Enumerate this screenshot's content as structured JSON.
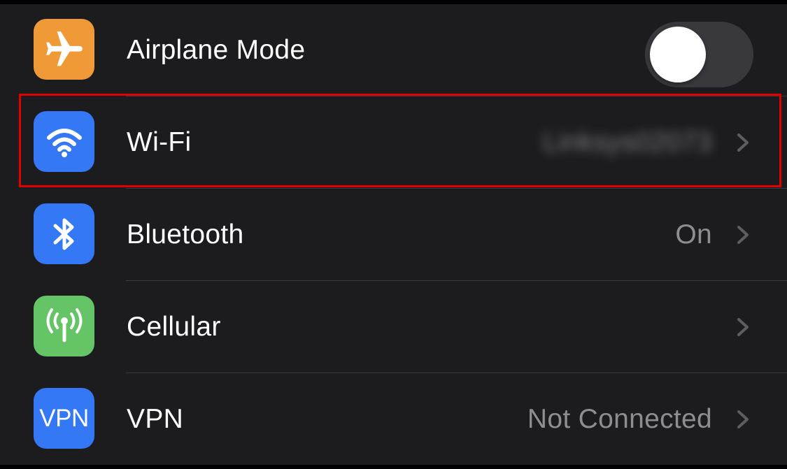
{
  "settings": {
    "rows": [
      {
        "label": "Airplane Mode",
        "icon": "airplane-icon",
        "icon_color": "#f09a37",
        "toggle_on": false
      },
      {
        "label": "Wi-Fi",
        "icon": "wifi-icon",
        "icon_color": "#3478f6",
        "value": "Linksys02073",
        "value_blurred": true
      },
      {
        "label": "Bluetooth",
        "icon": "bluetooth-icon",
        "icon_color": "#3478f6",
        "value": "On"
      },
      {
        "label": "Cellular",
        "icon": "cellular-antenna-icon",
        "icon_color": "#65c466",
        "value": ""
      },
      {
        "label": "VPN",
        "icon": "vpn-icon",
        "icon_color": "#3478f6",
        "icon_text": "VPN",
        "value": "Not Connected"
      }
    ]
  },
  "highlight": {
    "target": "Wi-Fi",
    "color": "#e00000"
  },
  "colors": {
    "background": "#1c1c1e",
    "label": "#ffffff",
    "secondary": "#8d8d93",
    "separator": "#3a3a3c",
    "toggle_off_track": "#39393d"
  }
}
